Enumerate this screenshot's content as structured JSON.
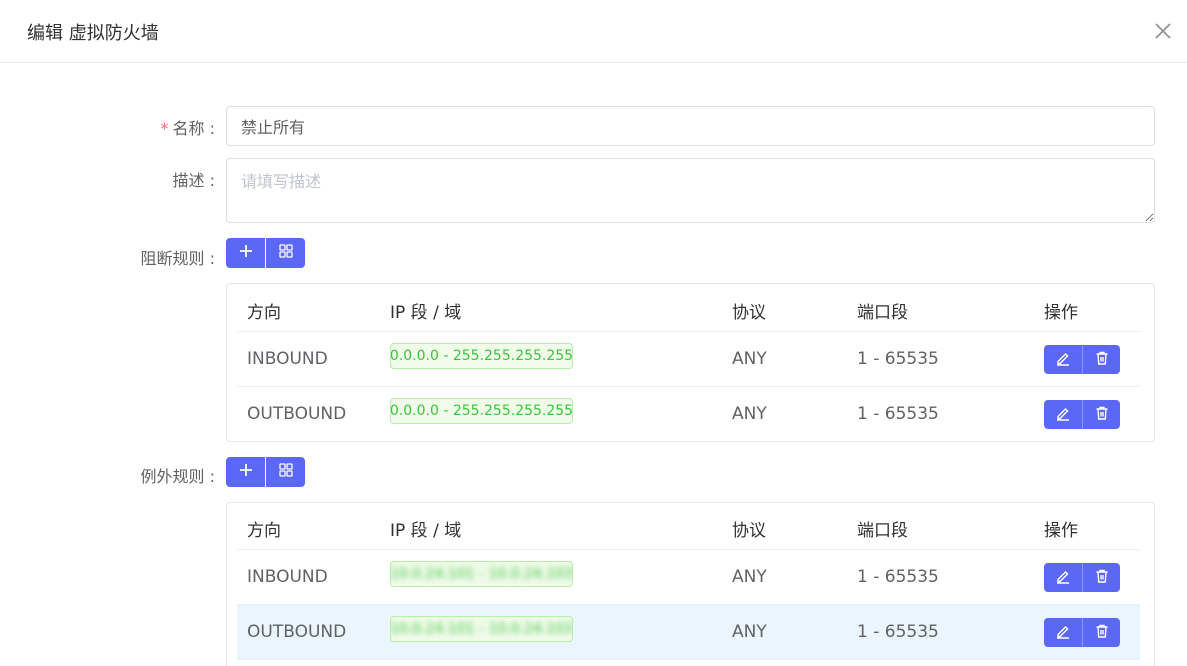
{
  "dialog": {
    "title": "编辑 虚拟防火墙"
  },
  "form": {
    "name_label": "名称 :",
    "name_required_mark": "*",
    "name_value": "禁止所有",
    "desc_label": "描述 :",
    "desc_placeholder": "请填写描述",
    "block_label": "阻断规则 :",
    "except_label": "例外规则 :"
  },
  "table_headers": {
    "direction": "方向",
    "ip": "IP 段 / 域",
    "protocol": "协议",
    "port": "端口段",
    "ops": "操作"
  },
  "block_rules": [
    {
      "direction": "INBOUND",
      "ip": "0.0.0.0 - 255.255.255.255",
      "protocol": "ANY",
      "port": "1 - 65535"
    },
    {
      "direction": "OUTBOUND",
      "ip": "0.0.0.0 - 255.255.255.255",
      "protocol": "ANY",
      "port": "1 - 65535"
    }
  ],
  "except_rules": [
    {
      "direction": "INBOUND",
      "ip": "10.0.24.101 - 10.0.24.103",
      "protocol": "ANY",
      "port": "1 - 65535"
    },
    {
      "direction": "OUTBOUND",
      "ip": "10.0.24.101 - 10.0.24.103",
      "protocol": "ANY",
      "port": "1 - 65535"
    }
  ],
  "colors": {
    "primary": "#5b67f5",
    "tag_green": "#3cc43c",
    "required": "#f56c6c",
    "row_highlight": "#ebf5fd"
  },
  "icons": {
    "close": "close-icon",
    "add": "plus-icon",
    "batch": "grid-icon",
    "edit": "edit-icon",
    "delete": "trash-icon"
  }
}
